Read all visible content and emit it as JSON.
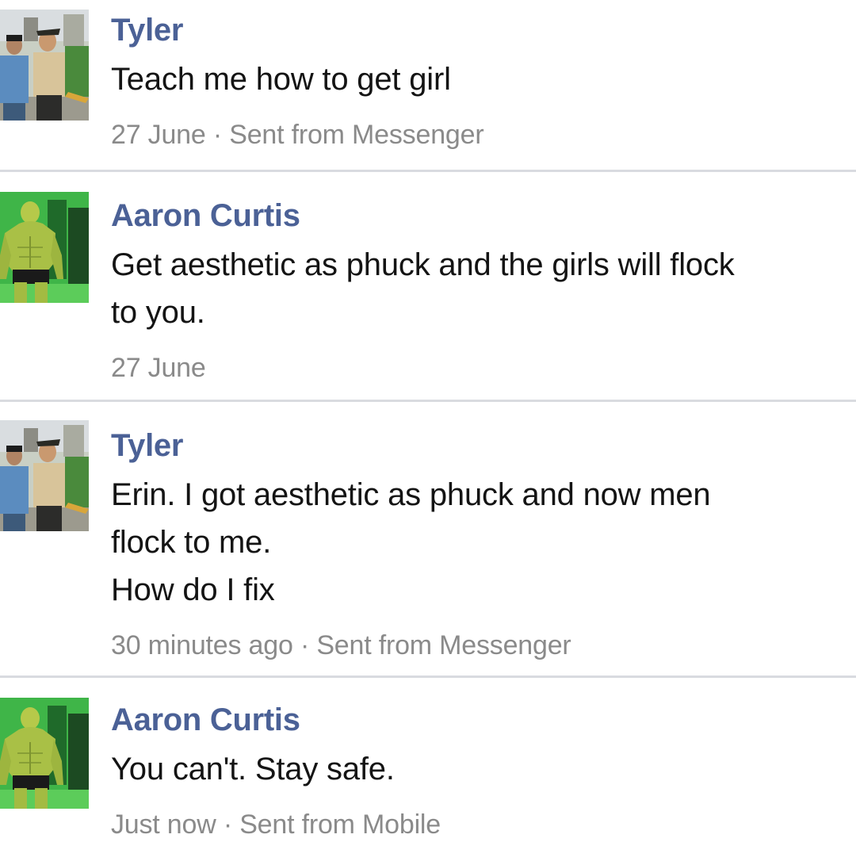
{
  "messages": [
    {
      "sender": "Tyler",
      "avatar": "tyler-avatar",
      "lines": [
        "Teach me how to get girl"
      ],
      "time": "27 June",
      "via": "Sent from Messenger"
    },
    {
      "sender": "Aaron Curtis",
      "avatar": "aaron-avatar",
      "lines": [
        "Get aesthetic as phuck and the girls will flock",
        "to you."
      ],
      "time": "27 June",
      "via": ""
    },
    {
      "sender": "Tyler",
      "avatar": "tyler-avatar",
      "lines": [
        "Erin. I got aesthetic as phuck and now men",
        "flock to me.",
        "How do I fix"
      ],
      "time": "30 minutes ago",
      "via": "Sent from Messenger"
    },
    {
      "sender": "Aaron Curtis",
      "avatar": "aaron-avatar",
      "lines": [
        "You can't. Stay safe."
      ],
      "time": "Just now",
      "via": "Sent from Mobile"
    }
  ],
  "meta_separator": " · ",
  "colors": {
    "sender": "#4b6196",
    "text": "#141414",
    "meta": "#8a8a8a",
    "divider": "#d9dbe0",
    "aaron_bg": "#3fb548"
  }
}
